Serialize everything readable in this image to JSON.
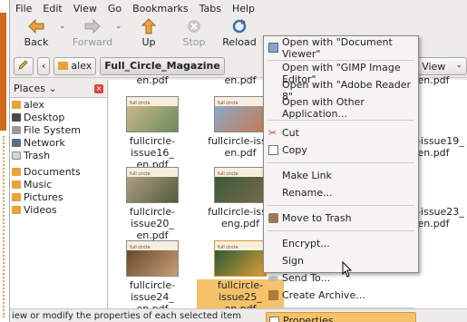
{
  "menubar": {
    "items": [
      "File",
      "Edit",
      "View",
      "Go",
      "Bookmarks",
      "Tabs",
      "Help"
    ]
  },
  "toolbar": {
    "back": "Back",
    "forward": "Forward",
    "up": "Up",
    "stop": "Stop",
    "reload": "Reload"
  },
  "location": {
    "home_crumb": "alex",
    "current_crumb": "Full_Circle_Magazine",
    "view_mode": "on View"
  },
  "sidebar": {
    "header": "Places",
    "items": [
      {
        "label": "alex",
        "icon": "home-icon"
      },
      {
        "label": "Desktop",
        "icon": "desktop-icon"
      },
      {
        "label": "File System",
        "icon": "drive-icon"
      },
      {
        "label": "Network",
        "icon": "network-icon"
      },
      {
        "label": "Trash",
        "icon": "trash-icon"
      },
      {
        "label": "Documents",
        "icon": "folder-icon"
      },
      {
        "label": "Music",
        "icon": "folder-icon"
      },
      {
        "label": "Pictures",
        "icon": "folder-icon"
      },
      {
        "label": "Videos",
        "icon": "folder-icon"
      }
    ]
  },
  "files": [
    {
      "line1": "en.pdf",
      "line2": ""
    },
    {
      "line1": "en.pdf",
      "line2": ""
    },
    {
      "line1": "en.pdf",
      "line2": ""
    },
    {
      "line1": "fullcircle-issue16_",
      "line2": "en.pdf"
    },
    {
      "line1": "fullcircle-issu",
      "line2": "en.pdf"
    },
    {
      "line1": "cle-issue19_",
      "line2": "en.pdf"
    },
    {
      "line1": "fullcircle-issue20_",
      "line2": "en.pdf"
    },
    {
      "line1": "fullcircle-issu",
      "line2": "eng.pdf"
    },
    {
      "line1": "cle-issue23_",
      "line2": "en.pdf"
    },
    {
      "line1": "fullcircle-issue24_",
      "line2": "en.pdf"
    },
    {
      "line1": "fullcircle-issue25_",
      "line2": "en.pdf"
    }
  ],
  "context_menu": {
    "open_document_viewer": "Open with \"Document Viewer\"",
    "open_gimp": "Open with \"GIMP Image Editor\"",
    "open_adobe": "Open with \"Adobe Reader 8\"",
    "open_other": "Open with Other Application...",
    "cut": "Cut",
    "copy": "Copy",
    "make_link": "Make Link",
    "rename": "Rename...",
    "move_to_trash": "Move to Trash",
    "encrypt": "Encrypt...",
    "sign": "Sign",
    "send_to": "Send To...",
    "create_archive": "Create Archive...",
    "properties": "Properties"
  },
  "statusbar": {
    "text": "iew or modify the properties of each selected item"
  },
  "colors": {
    "selection": "#f4c26b",
    "accent": "#d2691e"
  }
}
